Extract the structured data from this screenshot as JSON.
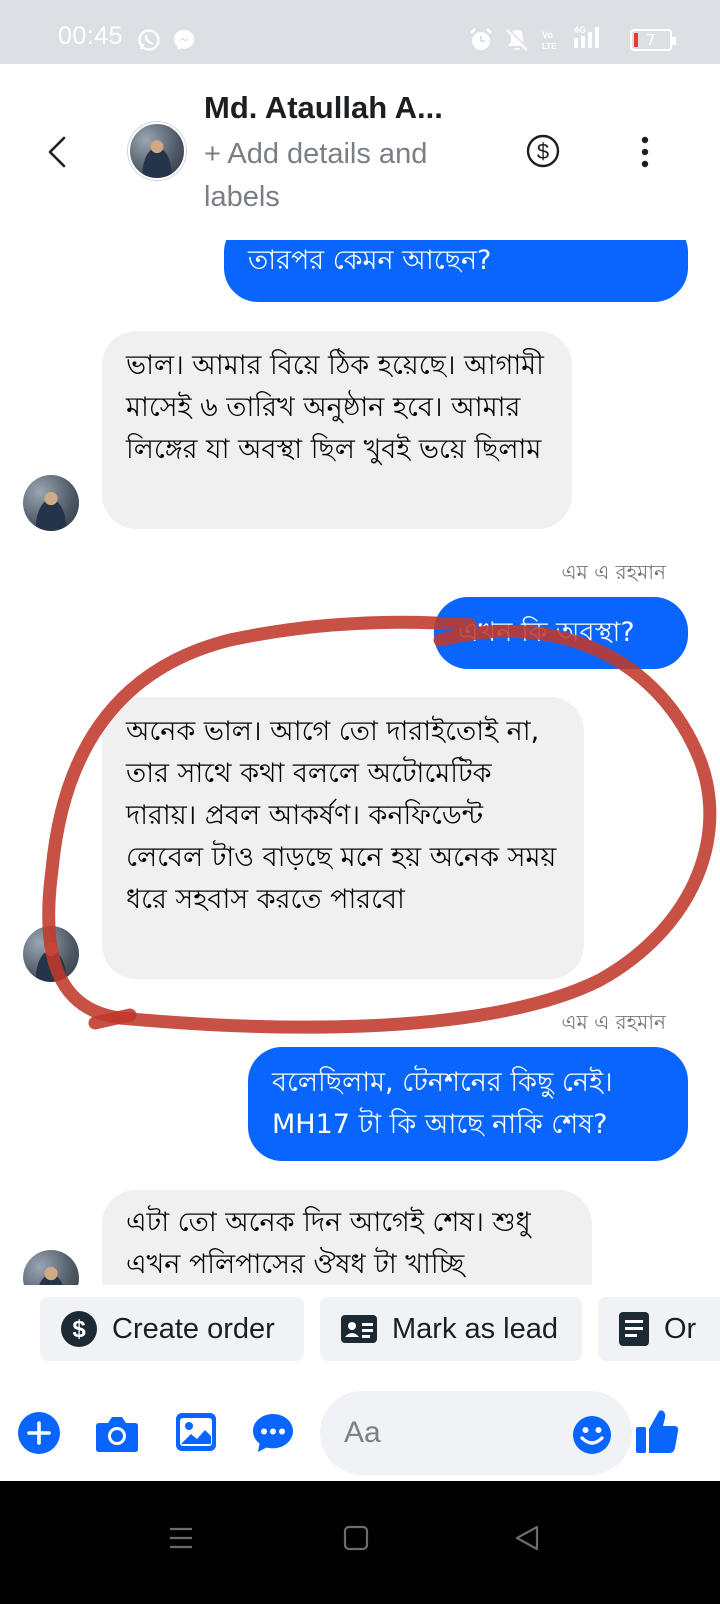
{
  "status_bar": {
    "time": "00:45",
    "network": "4G",
    "battery": "7",
    "icons": [
      "whatsapp-icon",
      "messenger-icon",
      "alarm-icon",
      "mute-icon",
      "volte-icon",
      "signal-icon",
      "battery-icon"
    ]
  },
  "header": {
    "name": "Md. Ataullah A...",
    "subtitle": "+ Add details and labels"
  },
  "messages": [
    {
      "direction": "out",
      "text": "তারপর কেমন আছেন?"
    },
    {
      "direction": "in",
      "text": "ভাল। আমার বিয়ে ঠিক হয়েছে। আগামী মাসেই ৬ তারিখ অনুষ্ঠান হবে। আমার লিঙ্গের যা অবস্থা ছিল খুবই ভয়ে ছিলাম"
    },
    {
      "direction": "out",
      "sender": "এম এ রহমান",
      "text": "এখন কি অবস্থা?"
    },
    {
      "direction": "in",
      "text": "অনেক ভাল। আগে তো দারাইতোই না, তার সাথে কথা বললে অটোমেটিক দারায়। প্রবল আকর্ষণ। কনফিডেন্ট লেবেল টাও বাড়ছে মনে হয় অনেক সময় ধরে সহবাস করতে পারবো"
    },
    {
      "direction": "out",
      "sender": "এম এ রহমান",
      "text": "বলেছিলাম, টেনশনের কিছু নেই। MH17 টা কি আছে নাকি শেষ?"
    },
    {
      "direction": "in",
      "text": "এটা তো অনেক দিন আগেই শেষ। শুধু এখন পলিপাসের ঔষধ টা খাচ্ছি"
    }
  ],
  "quick_actions": [
    {
      "label": "Create order",
      "icon": "dollar-icon"
    },
    {
      "label": "Mark as lead",
      "icon": "contact-card-icon"
    },
    {
      "label": "Or",
      "icon": "document-icon"
    }
  ],
  "composer": {
    "placeholder": "Aa"
  },
  "colors": {
    "accent": "#0866ff",
    "incoming_bubble": "#f0f0f0",
    "annotation": "#c0392b"
  }
}
